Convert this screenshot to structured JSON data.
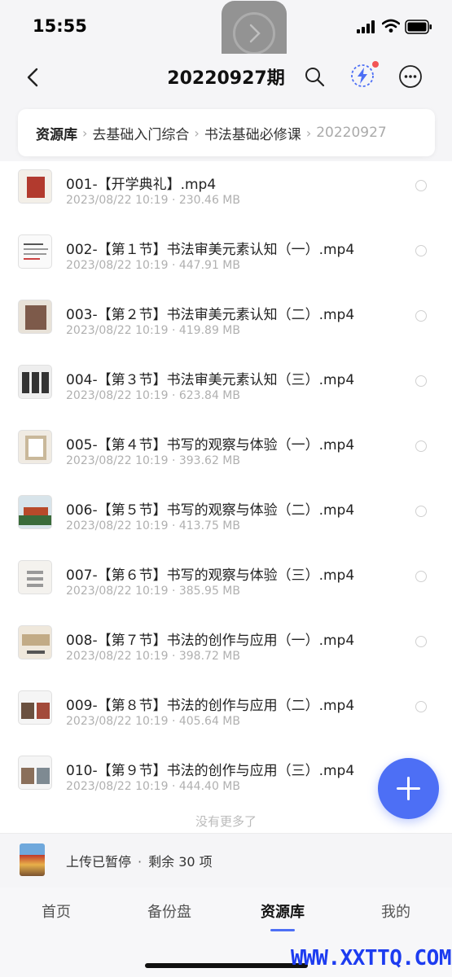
{
  "status_bar": {
    "time": "15:55"
  },
  "nav": {
    "title": "20220927期"
  },
  "breadcrumb": {
    "items": [
      "资源库",
      "去基础入门综合",
      "书法基础必修课",
      "20220927"
    ]
  },
  "files": [
    {
      "name": "001-【开学典礼】.mp4",
      "date": "2023/08/22 10:19",
      "size": "230.46 MB"
    },
    {
      "name": "002-【第１节】书法审美元素认知（一）.mp4",
      "date": "2023/08/22 10:19",
      "size": "447.91 MB"
    },
    {
      "name": "003-【第２节】书法审美元素认知（二）.mp4",
      "date": "2023/08/22 10:19",
      "size": "419.89 MB"
    },
    {
      "name": "004-【第３节】书法审美元素认知（三）.mp4",
      "date": "2023/08/22 10:19",
      "size": "623.84 MB"
    },
    {
      "name": "005-【第４节】书写的观察与体验（一）.mp4",
      "date": "2023/08/22 10:19",
      "size": "393.62 MB"
    },
    {
      "name": "006-【第５节】书写的观察与体验（二）.mp4",
      "date": "2023/08/22 10:19",
      "size": "413.75 MB"
    },
    {
      "name": "007-【第６节】书写的观察与体验（三）.mp4",
      "date": "2023/08/22 10:19",
      "size": "385.95 MB"
    },
    {
      "name": "008-【第７节】书法的创作与应用（一）.mp4",
      "date": "2023/08/22 10:19",
      "size": "398.72 MB"
    },
    {
      "name": "009-【第８节】书法的创作与应用（二）.mp4",
      "date": "2023/08/22 10:19",
      "size": "405.64 MB"
    },
    {
      "name": "010-【第９节】书法的创作与应用（三）.mp4",
      "date": "2023/08/22 10:19",
      "size": "444.40 MB"
    }
  ],
  "meta_separator": "·",
  "no_more_text": "没有更多了",
  "upload": {
    "status": "上传已暂停",
    "separator": "·",
    "remaining": "剩余 30 项"
  },
  "tabs": [
    {
      "label": "首页",
      "active": false
    },
    {
      "label": "备份盘",
      "active": false
    },
    {
      "label": "资源库",
      "active": true
    },
    {
      "label": "我的",
      "active": false
    }
  ],
  "watermark": "WWW.XXTTQ.COM",
  "colors": {
    "accent": "#4d6ff5",
    "badge": "#f25454",
    "watermark": "#1d3cf0"
  }
}
